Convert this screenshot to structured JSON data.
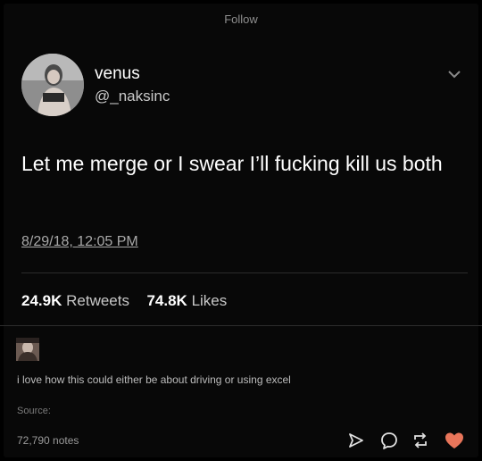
{
  "header": {
    "follow_label": "Follow"
  },
  "tweet": {
    "display_name": "venus",
    "handle": "@_naksinc",
    "text": "Let me merge or I swear I’ll fucking kill us both",
    "timestamp": "8/29/18, 12:05 PM",
    "retweets_count": "24.9K",
    "retweets_label": "Retweets",
    "likes_count": "74.8K",
    "likes_label": "Likes"
  },
  "post": {
    "caption": "i love how this could either be about driving or using excel",
    "source_label": "Source:",
    "notes": "72,790 notes"
  },
  "colors": {
    "background": "#000000",
    "text_primary": "#ffffff",
    "text_secondary": "#a8a8a8",
    "heart": "#e8755a"
  },
  "icons": [
    "chevron-down-icon",
    "send-icon",
    "reply-icon",
    "reblog-icon",
    "heart-icon"
  ]
}
